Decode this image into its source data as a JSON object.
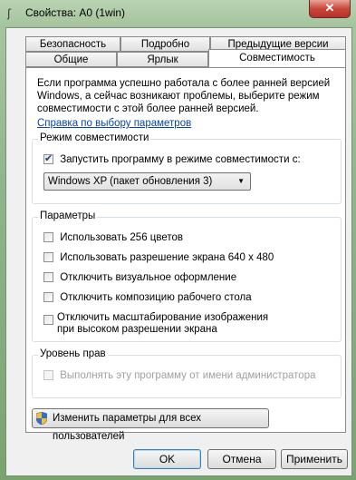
{
  "window": {
    "title": "Свойства: A0 (1win)",
    "app_icon": "ʃ",
    "close_symbol": "✕"
  },
  "tabs_back": [
    "Безопасность",
    "Подробно",
    "Предыдущие версии"
  ],
  "tabs_front": [
    "Общие",
    "Ярлык",
    "Совместимость"
  ],
  "intro_text": "Если программа успешно работала с более ранней версией Windows, а сейчас возникают проблемы, выберите режим совместимости с этой более ранней версией.",
  "help_link": "Справка по выбору параметров",
  "compat_group": {
    "title": "Режим совместимости",
    "checkbox_label": "Запустить программу в режиме совместимости с:",
    "checked": true,
    "selected_os": "Windows XP (пакет обновления 3)"
  },
  "params_group": {
    "title": "Параметры",
    "options": [
      "Использовать 256 цветов",
      "Использовать разрешение экрана 640 x 480",
      "Отключить визуальное оформление",
      "Отключить композицию рабочего стола",
      "Отключить масштабирование изображения при высоком разрешении экрана"
    ]
  },
  "rights_group": {
    "title": "Уровень прав",
    "admin_label": "Выполнять эту программу от имени администратора"
  },
  "change_all_button": "Изменить параметры для всех пользователей",
  "buttons": {
    "ok": "OK",
    "cancel": "Отмена",
    "apply": "Применить"
  }
}
